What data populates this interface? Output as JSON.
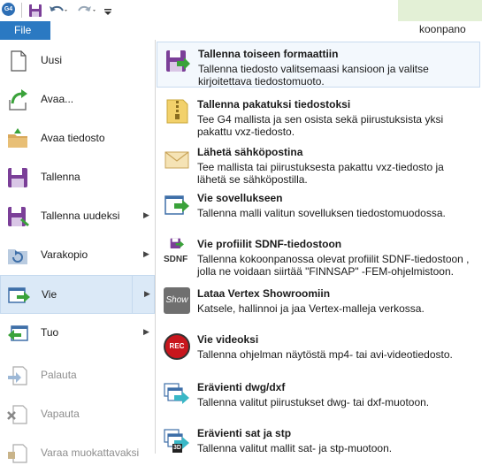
{
  "app": {
    "logo_text": "G4"
  },
  "ribbon": {
    "file_tab": "File",
    "right_label": "koonpano"
  },
  "left_menu": [
    {
      "label": "Uusi",
      "icon": "new-document-icon",
      "arrow": false,
      "disabled": false
    },
    {
      "label": "Avaa...",
      "icon": "open-arrow-icon",
      "arrow": false,
      "disabled": false
    },
    {
      "label": "Avaa tiedosto",
      "icon": "open-folder-icon",
      "arrow": false,
      "disabled": false
    },
    {
      "label": "Tallenna",
      "icon": "save-floppy-icon",
      "arrow": false,
      "disabled": false
    },
    {
      "label": "Tallenna uudeksi",
      "icon": "save-as-icon",
      "arrow": true,
      "disabled": false
    },
    {
      "label": "Varakopio",
      "icon": "backup-icon",
      "arrow": true,
      "disabled": false
    },
    {
      "label": "Vie",
      "icon": "export-icon",
      "arrow": true,
      "disabled": false,
      "selected": true
    },
    {
      "label": "Tuo",
      "icon": "import-icon",
      "arrow": true,
      "disabled": false
    },
    {
      "label": "Palauta",
      "icon": "restore-icon",
      "arrow": false,
      "disabled": true
    },
    {
      "label": "Vapauta",
      "icon": "release-icon",
      "arrow": false,
      "disabled": true
    },
    {
      "label": "Varaa muokattavaksi",
      "icon": "reserve-icon",
      "arrow": false,
      "disabled": true
    }
  ],
  "submenu": [
    {
      "title": "Tallenna toiseen formaattiin",
      "desc": "Tallenna tiedosto valitsemaasi kansioon ja valitse kirjoitettava tiedostomuoto.",
      "icon": "save-format-icon"
    },
    {
      "title": "Tallenna pakatuksi tiedostoksi",
      "desc": "Tee G4 mallista ja sen osista sekä piirustuksista yksi pakattu vxz-tiedosto.",
      "icon": "zip-file-icon"
    },
    {
      "title": "Lähetä sähköpostina",
      "desc": "Tee mallista tai piirustuksesta pakattu vxz-tiedosto ja lähetä se sähköpostilla.",
      "icon": "envelope-icon"
    },
    {
      "title": "Vie sovellukseen",
      "desc": "Tallenna malli valitun sovelluksen tiedostomuodossa.",
      "icon": "export-app-icon"
    },
    {
      "title": "Vie profiilit SDNF-tiedostoon",
      "desc": "Tallenna kokoonpanossa olevat profiilit SDNF-tiedostoon , jolla ne voidaan siirtää \"FINNSAP\" -FEM-ohjelmistoon.",
      "icon": "sdnf-icon",
      "icon_text": "SDNF"
    },
    {
      "title": "Lataa Vertex Showroomiin",
      "desc": "Katsele, hallinnoi ja jaa Vertex-malleja verkossa.",
      "icon": "showroom-icon",
      "icon_text": "Show"
    },
    {
      "title": "Vie videoksi",
      "desc": "Tallenna ohjelman näytöstä mp4- tai avi-videotiedosto.",
      "icon": "record-video-icon",
      "icon_text": "REC"
    },
    {
      "title": "Erävienti dwg/dxf",
      "desc": "Tallenna valitut piirustukset dwg- tai dxf-muotoon.",
      "icon": "batch-dwg-icon"
    },
    {
      "title": "Erävienti sat ja stp",
      "desc": "Tallenna valitut mallit sat- ja stp-muotoon.",
      "icon": "batch-sat-icon",
      "icon_text": "3D"
    }
  ],
  "colors": {
    "accent": "#2b79c2",
    "selection": "#dbe9f7",
    "purple": "#7b3f98",
    "green_arrow": "#3aa23a"
  }
}
